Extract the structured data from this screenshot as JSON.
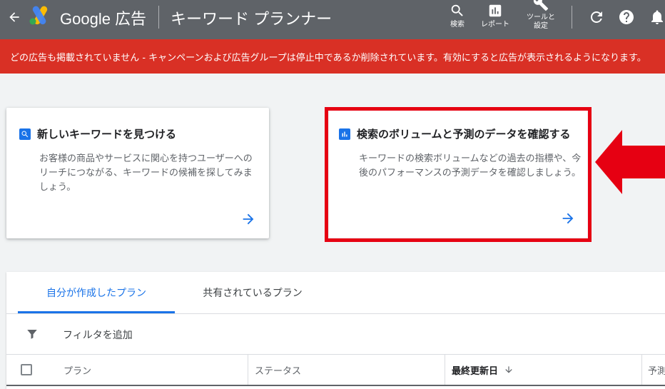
{
  "header": {
    "brand": "Google 広告",
    "page_title": "キーワード プランナー",
    "tools": [
      {
        "label": "検索",
        "icon": "search-icon"
      },
      {
        "label": "レポート",
        "icon": "report-icon"
      },
      {
        "label": "ツールと\n設定",
        "icon": "wrench-icon"
      }
    ],
    "icons": [
      "refresh-icon",
      "help-icon",
      "notifications-icon"
    ]
  },
  "banner": {
    "text": "どの広告も掲載されていません - キャンペーンおよび広告グループは停止中であるか削除されています。有効にすると広告が表示されるようになります。",
    "color": "#d93025"
  },
  "cards": [
    {
      "title": "新しいキーワードを見つける",
      "description": "お客様の商品やサービスに関心を持つユーザーへのリーチにつながる、キーワードの候補を探してみましょう。",
      "icon": "search-icon"
    },
    {
      "title": "検索のボリュームと予測のデータを確認する",
      "description": "キーワードの検索ボリュームなどの過去の指標や、今後のパフォーマンスの予測データを確認しましょう。",
      "icon": "bar-chart-icon"
    }
  ],
  "annotation_color": "#e60012",
  "tabs": [
    {
      "label": "自分が作成したプラン",
      "active": true
    },
    {
      "label": "共有されているプラン",
      "active": false
    }
  ],
  "filter": {
    "label": "フィルタを追加"
  },
  "table": {
    "columns": [
      "プラン",
      "ステータス",
      "最終更新日",
      "予測"
    ]
  },
  "accent_color": "#1a73e8"
}
